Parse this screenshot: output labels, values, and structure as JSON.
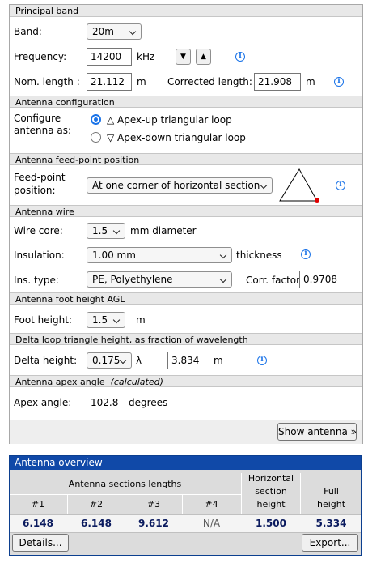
{
  "principal": {
    "header": "Principal band",
    "band_label": "Band:",
    "band_value": "20m",
    "freq_label": "Frequency:",
    "freq_value": "14200",
    "freq_unit": "kHz",
    "down_arrow": "▼",
    "up_arrow": "▲",
    "nom_label": "Nom. length :",
    "nom_value": "21.112",
    "nom_unit": "m",
    "corr_label": "Corrected length:",
    "corr_value": "21.908",
    "corr_unit": "m"
  },
  "config": {
    "header": "Antenna configuration",
    "label_line1": "Configure",
    "label_line2": "antenna as:",
    "option1": "△ Apex-up triangular loop",
    "option2": "▽ Apex-down triangular loop",
    "selected": 1
  },
  "feed": {
    "header": "Antenna feed-point position",
    "label_line1": "Feed-point",
    "label_line2": "position:",
    "value": "At one corner of horizontal section"
  },
  "wire": {
    "header": "Antenna wire",
    "core_label": "Wire core:",
    "core_value": "1.5",
    "core_unit": "mm  diameter",
    "ins_label": "Insulation:",
    "ins_value": "1.00 mm",
    "ins_unit": "thickness",
    "type_label": "Ins. type:",
    "type_value": "PE, Polyethylene",
    "cf_label": "Corr. factor:",
    "cf_value": "0.9708"
  },
  "foot": {
    "header": "Antenna foot height AGL",
    "label": "Foot height:",
    "value": "1.5",
    "unit": "m"
  },
  "delta": {
    "header": "Delta loop triangle height, as fraction of wavelength",
    "label": "Delta height:",
    "value": "0.175",
    "lambda": "λ",
    "meters": "3.834",
    "unit": "m"
  },
  "apex": {
    "header": "Antenna apex angle",
    "header_note": "(calculated)",
    "label": "Apex angle:",
    "value": "102.8",
    "unit": "degrees"
  },
  "show_button": "Show antenna »",
  "overview": {
    "title": "Antenna overview",
    "sections_header": "Antenna sections lengths",
    "horiz_header_1": "Horizontal",
    "horiz_header_2": "section",
    "horiz_header_3": "height",
    "full_header_1": "Full",
    "full_header_2": "height",
    "cols": [
      "#1",
      "#2",
      "#3",
      "#4"
    ],
    "values": [
      "6.148",
      "6.148",
      "9.612",
      "N/A"
    ],
    "horiz_value": "1.500",
    "full_value": "5.334",
    "details_button": "Details...",
    "export_button": "Export..."
  },
  "colors": {
    "accent": "#1a73e8",
    "overview_header": "#1049a8",
    "feed_dot": "#e00000"
  }
}
